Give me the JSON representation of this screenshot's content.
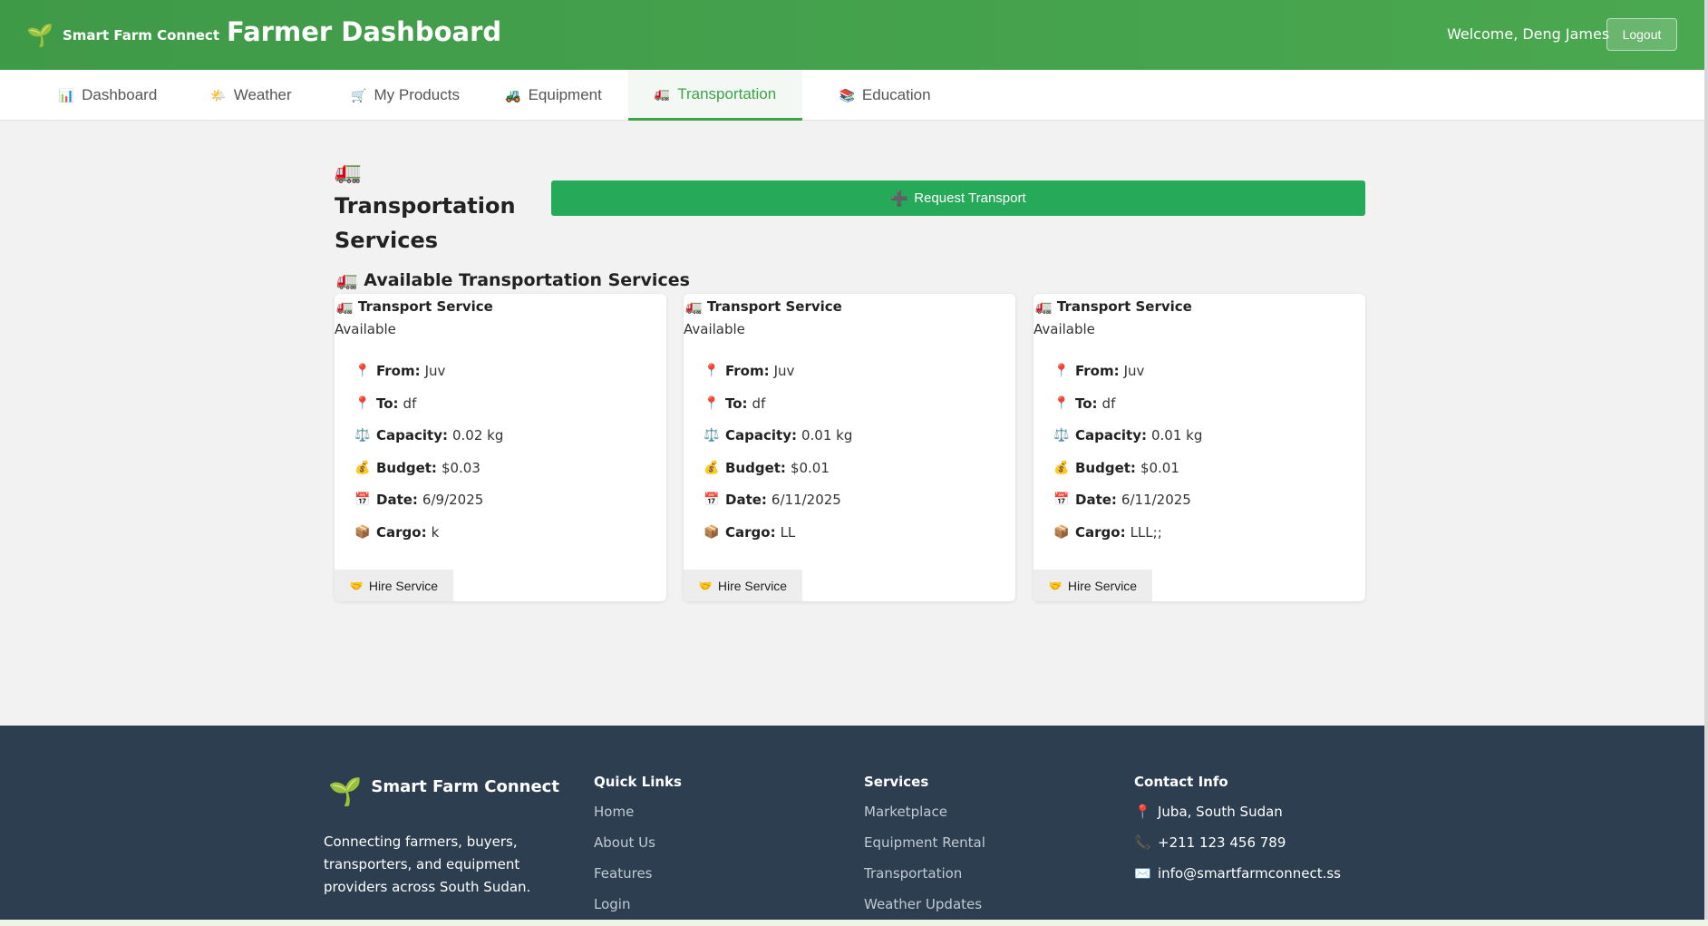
{
  "header": {
    "brand_icon": "🌱",
    "brand_name": "Smart Farm Connect",
    "title": "Farmer Dashboard",
    "welcome": "Welcome, Deng James",
    "logout_label": "Logout",
    "accent_color": "#4aa850"
  },
  "tabs": [
    {
      "icon": "📊",
      "label": "Dashboard"
    },
    {
      "icon": "🌤️",
      "label": "Weather"
    },
    {
      "icon": "🛒",
      "label": "My Products"
    },
    {
      "icon": "🚜",
      "label": "Equipment"
    },
    {
      "icon": "🚛",
      "label": "Transportation",
      "active": true
    },
    {
      "icon": "📚",
      "label": "Education"
    }
  ],
  "main": {
    "section_icon": "🚛",
    "section_title": "Transportation Services",
    "request_icon": "➕",
    "request_label": "Request Transport",
    "available_icon": "🚛",
    "available_title": "Available Transportation Services",
    "labels": {
      "from": "From:",
      "to": "To:",
      "capacity": "Capacity:",
      "budget": "Budget:",
      "date": "Date:",
      "cargo": "Cargo:"
    },
    "icons": {
      "from": "📍",
      "to": "📍",
      "capacity": "⚖️",
      "budget": "💰",
      "date": "📅",
      "cargo": "📦",
      "hire": "🤝"
    },
    "cards": [
      {
        "icon": "🚛",
        "title": "Transport Service",
        "status": "Available",
        "from": "Juv",
        "to": "df",
        "capacity": "0.02 kg",
        "budget": "$0.03",
        "date": "6/9/2025",
        "cargo": "k",
        "hire_label": "Hire Service"
      },
      {
        "icon": "🚛",
        "title": "Transport Service",
        "status": "Available",
        "from": "Juv",
        "to": "df",
        "capacity": "0.01 kg",
        "budget": "$0.01",
        "date": "6/11/2025",
        "cargo": "LL",
        "hire_label": "Hire Service"
      },
      {
        "icon": "🚛",
        "title": "Transport Service",
        "status": "Available",
        "from": "Juv",
        "to": "df",
        "capacity": "0.01 kg",
        "budget": "$0.01",
        "date": "6/11/2025",
        "cargo": "LLL;;",
        "hire_label": "Hire Service"
      }
    ]
  },
  "footer": {
    "brand_icon": "🌱",
    "brand_name": "Smart Farm Connect",
    "description": "Connecting farmers, buyers, transporters, and equipment providers across South Sudan.",
    "quick_links_title": "Quick Links",
    "quick_links": [
      "Home",
      "About Us",
      "Features",
      "Login"
    ],
    "services_title": "Services",
    "services": [
      "Marketplace",
      "Equipment Rental",
      "Transportation",
      "Weather Updates"
    ],
    "contact_title": "Contact Info",
    "contacts": [
      {
        "icon": "📍",
        "text": "Juba, South Sudan"
      },
      {
        "icon": "📞",
        "text": "+211 123 456 789"
      },
      {
        "icon": "✉️",
        "text": "info@smartfarmconnect.ss"
      }
    ]
  }
}
